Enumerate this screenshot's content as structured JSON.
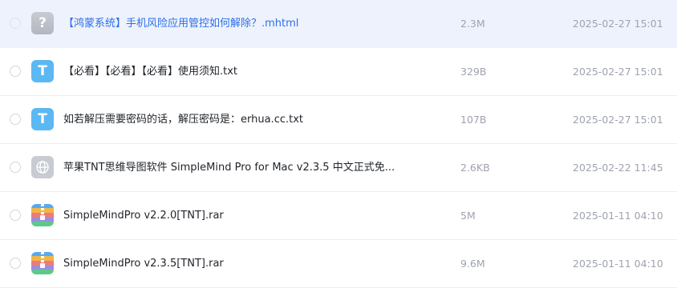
{
  "files": [
    {
      "name": "【鸿蒙系统】手机风险应用管控如何解除？.mhtml",
      "size": "2.3M",
      "date": "2025-02-27 15:01",
      "icon": "unknown-file-icon",
      "icon_glyph": "?",
      "selected": true
    },
    {
      "name": "【必看】【必看】【必看】使用须知.txt",
      "size": "329B",
      "date": "2025-02-27 15:01",
      "icon": "text-file-icon",
      "icon_glyph": "T",
      "selected": false
    },
    {
      "name": "如若解压需要密码的话，解压密码是：erhua.cc.txt",
      "size": "107B",
      "date": "2025-02-27 15:01",
      "icon": "text-file-icon",
      "icon_glyph": "T",
      "selected": false
    },
    {
      "name": "苹果TNT思维导图软件 SimpleMind Pro for Mac v2.3.5 中文正式免...",
      "size": "2.6KB",
      "date": "2025-02-22 11:45",
      "icon": "web-link-icon",
      "selected": false
    },
    {
      "name": "SimpleMindPro v2.2.0[TNT].rar",
      "size": "5M",
      "date": "2025-01-11 04:10",
      "icon": "archive-file-icon",
      "selected": false
    },
    {
      "name": "SimpleMindPro v2.3.5[TNT].rar",
      "size": "9.6M",
      "date": "2025-01-11 04:10",
      "icon": "archive-file-icon",
      "selected": false
    }
  ],
  "colors": {
    "selected_row_bg": "#eef2fc",
    "selected_text": "#2b6fe8",
    "text_icon_bg": "#5cb8f2",
    "meta_text": "#9ea3ad"
  }
}
